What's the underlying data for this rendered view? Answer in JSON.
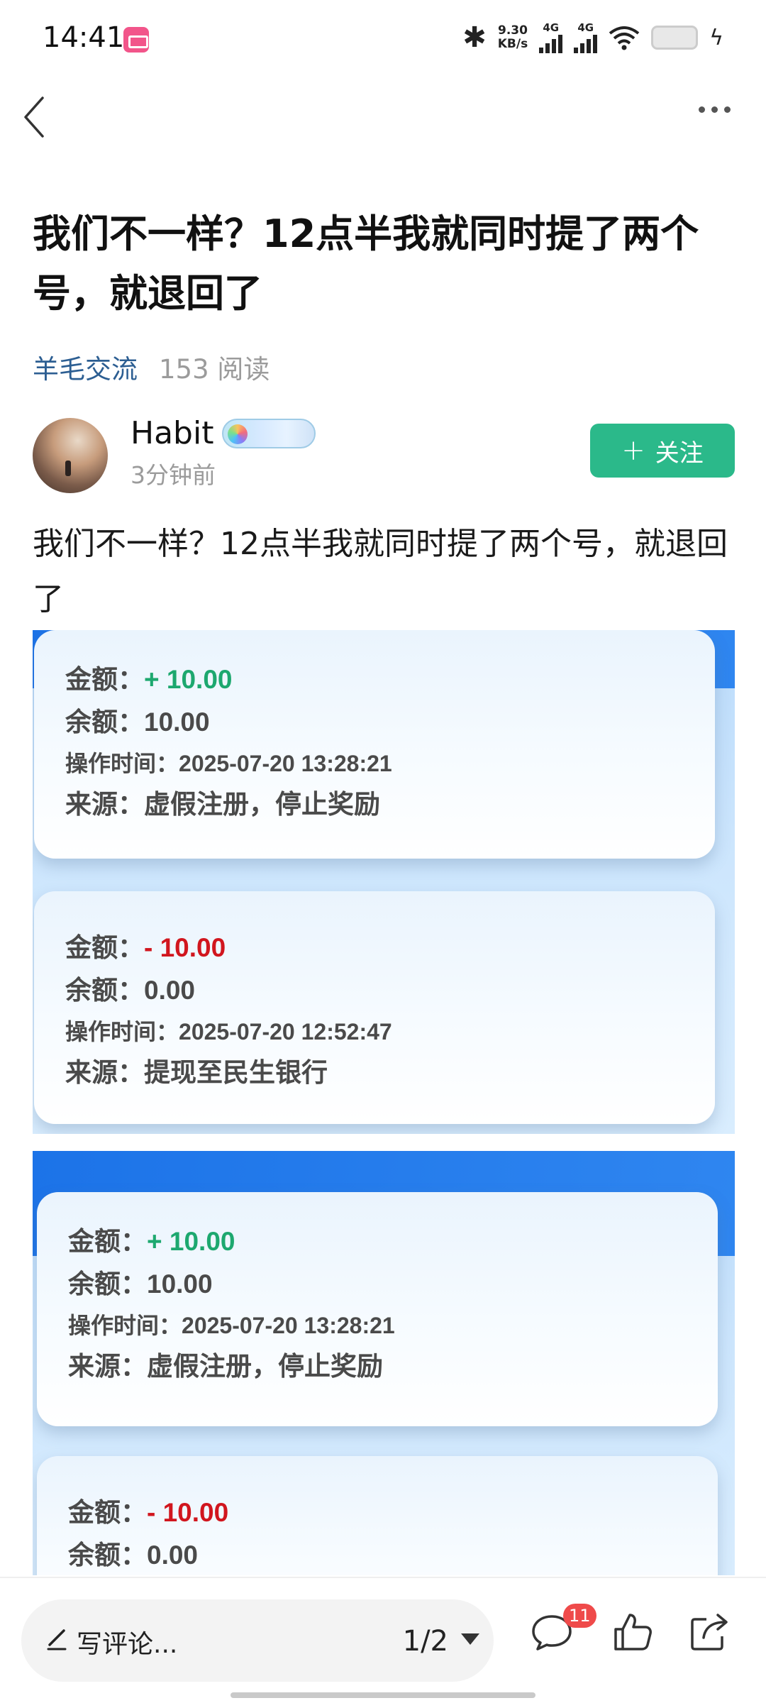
{
  "status_bar": {
    "time": "14:41",
    "net_speed": "9.30",
    "net_speed_unit": "KB/s",
    "signal_1": "4G",
    "signal_2": "4G"
  },
  "post": {
    "title": "我们不一样？12点半我就同时提了两个号，就退回了",
    "category": "羊毛交流",
    "reads": "153 阅读",
    "author": {
      "name": "Habit",
      "time": "3分钟前",
      "follow_label": "关注"
    },
    "body": "我们不一样？12点半我就同时提了两个号，就退回了"
  },
  "images": [
    {
      "records": [
        {
          "amount_label": "金额：",
          "amount": "+ 10.00",
          "balance_label": "余额：",
          "balance": "10.00",
          "time_label": "操作时间：",
          "time": "2025-07-20 13:28:21",
          "source_label": "来源：",
          "source": "虚假注册，停止奖励"
        },
        {
          "amount_label": "金额：",
          "amount": "- 10.00",
          "balance_label": "余额：",
          "balance": "0.00",
          "time_label": "操作时间：",
          "time": "2025-07-20 12:52:47",
          "source_label": "来源：",
          "source": "提现至民生银行"
        }
      ]
    },
    {
      "records": [
        {
          "amount_label": "金额：",
          "amount": "+ 10.00",
          "balance_label": "余额：",
          "balance": "10.00",
          "time_label": "操作时间：",
          "time": "2025-07-20 13:28:21",
          "source_label": "来源：",
          "source": "虚假注册，停止奖励"
        },
        {
          "amount_label": "金额：",
          "amount": "- 10.00",
          "balance_label": "余额：",
          "balance": "0.00"
        }
      ]
    }
  ],
  "bottom_bar": {
    "comment_placeholder": "写评论...",
    "pager": "1/2",
    "comment_count": "11"
  },
  "icons": {
    "back": "chevron-left-icon",
    "more": "more-dots-icon",
    "follow": "plus-icon",
    "write": "pen-icon",
    "comment": "comment-bubble-icon",
    "like": "thumbs-up-icon",
    "share": "share-icon"
  },
  "colors": {
    "accent_green": "#2bb98a",
    "category_blue": "#2c5e92",
    "positive": "#1da86f",
    "negative": "#d1161e",
    "badge_red": "#ef4a4a"
  }
}
